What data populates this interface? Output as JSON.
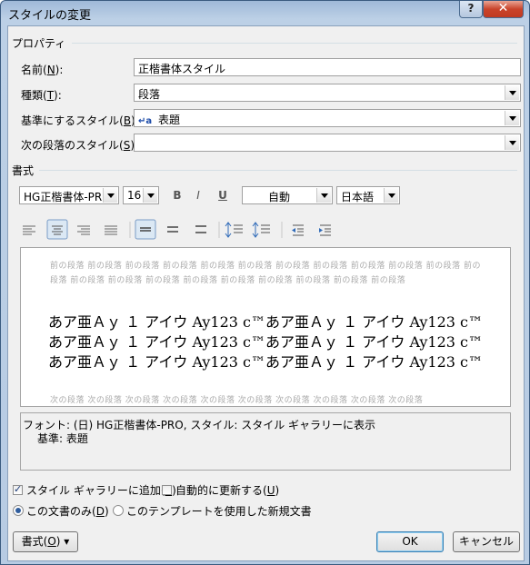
{
  "window": {
    "title": "スタイルの変更",
    "help_label": "?",
    "close_label": "✕"
  },
  "properties": {
    "section_label": "プロパティ",
    "name_label": "名前(",
    "name_key": "N",
    "name_tail": "):",
    "name_value": "正楷書体スタイル",
    "type_label": "種類(",
    "type_key": "T",
    "type_tail": "):",
    "type_value": "段落",
    "base_label": "基準にするスタイル(",
    "base_key": "B",
    "base_tail": "):",
    "base_icon_glyph": "↵a",
    "base_value": "表題",
    "next_label": "次の段落のスタイル(",
    "next_key": "S",
    "next_tail": "):",
    "next_value": ""
  },
  "format": {
    "section_label": "書式",
    "font_value": "HG正楷書体-PR",
    "size_value": "16",
    "bold_label": "B",
    "italic_label": "I",
    "underline_label": "U",
    "color_value": "自動",
    "lang_value": "日本語"
  },
  "preview": {
    "prev_text": "前の段落 前の段落 前の段落 前の段落 前の段落 前の段落 前の段落 前の段落 前の段落 前の段落 前の段落 前の段落 前の段落 前の段落 前の段落 前の段落 前の段落 前の段落 前の段落 前の段落 前の段落",
    "sample_text": "あア亜Ａｙ １ アイウ Ay123 c™あア亜Ａｙ １ アイウ Ay123 c™あア亜Ａｙ １ アイウ Ay123 c™あア亜Ａｙ １ アイウ Ay123 c™あア亜Ａｙ １ アイウ Ay123 c™あア亜Ａｙ １ アイウ Ay123 c™",
    "next_text": "次の段落 次の段落 次の段落 次の段落 次の段落 次の段落 次の段落 次の段落 次の段落 次の段落"
  },
  "description": {
    "line1": "フォント: (日) HG正楷書体-PRO, スタイル: スタイル ギャラリーに表示",
    "line2": "基準: 表題"
  },
  "options": {
    "add_gallery_label": "スタイル ギャラリーに追加(",
    "add_gallery_key": "S",
    "add_gallery_tail": ")",
    "add_gallery_checked": true,
    "auto_update_label": "自動的に更新する(",
    "auto_update_key": "U",
    "auto_update_tail": ")",
    "auto_update_checked": false,
    "this_doc_label": "この文書のみ(",
    "this_doc_key": "D",
    "this_doc_tail": ")",
    "template_label": "このテンプレートを使用した新規文書"
  },
  "buttons": {
    "format_label": "書式(",
    "format_key": "O",
    "format_tail": ") ▾",
    "ok_label": "OK",
    "cancel_label": "キャンセル"
  }
}
